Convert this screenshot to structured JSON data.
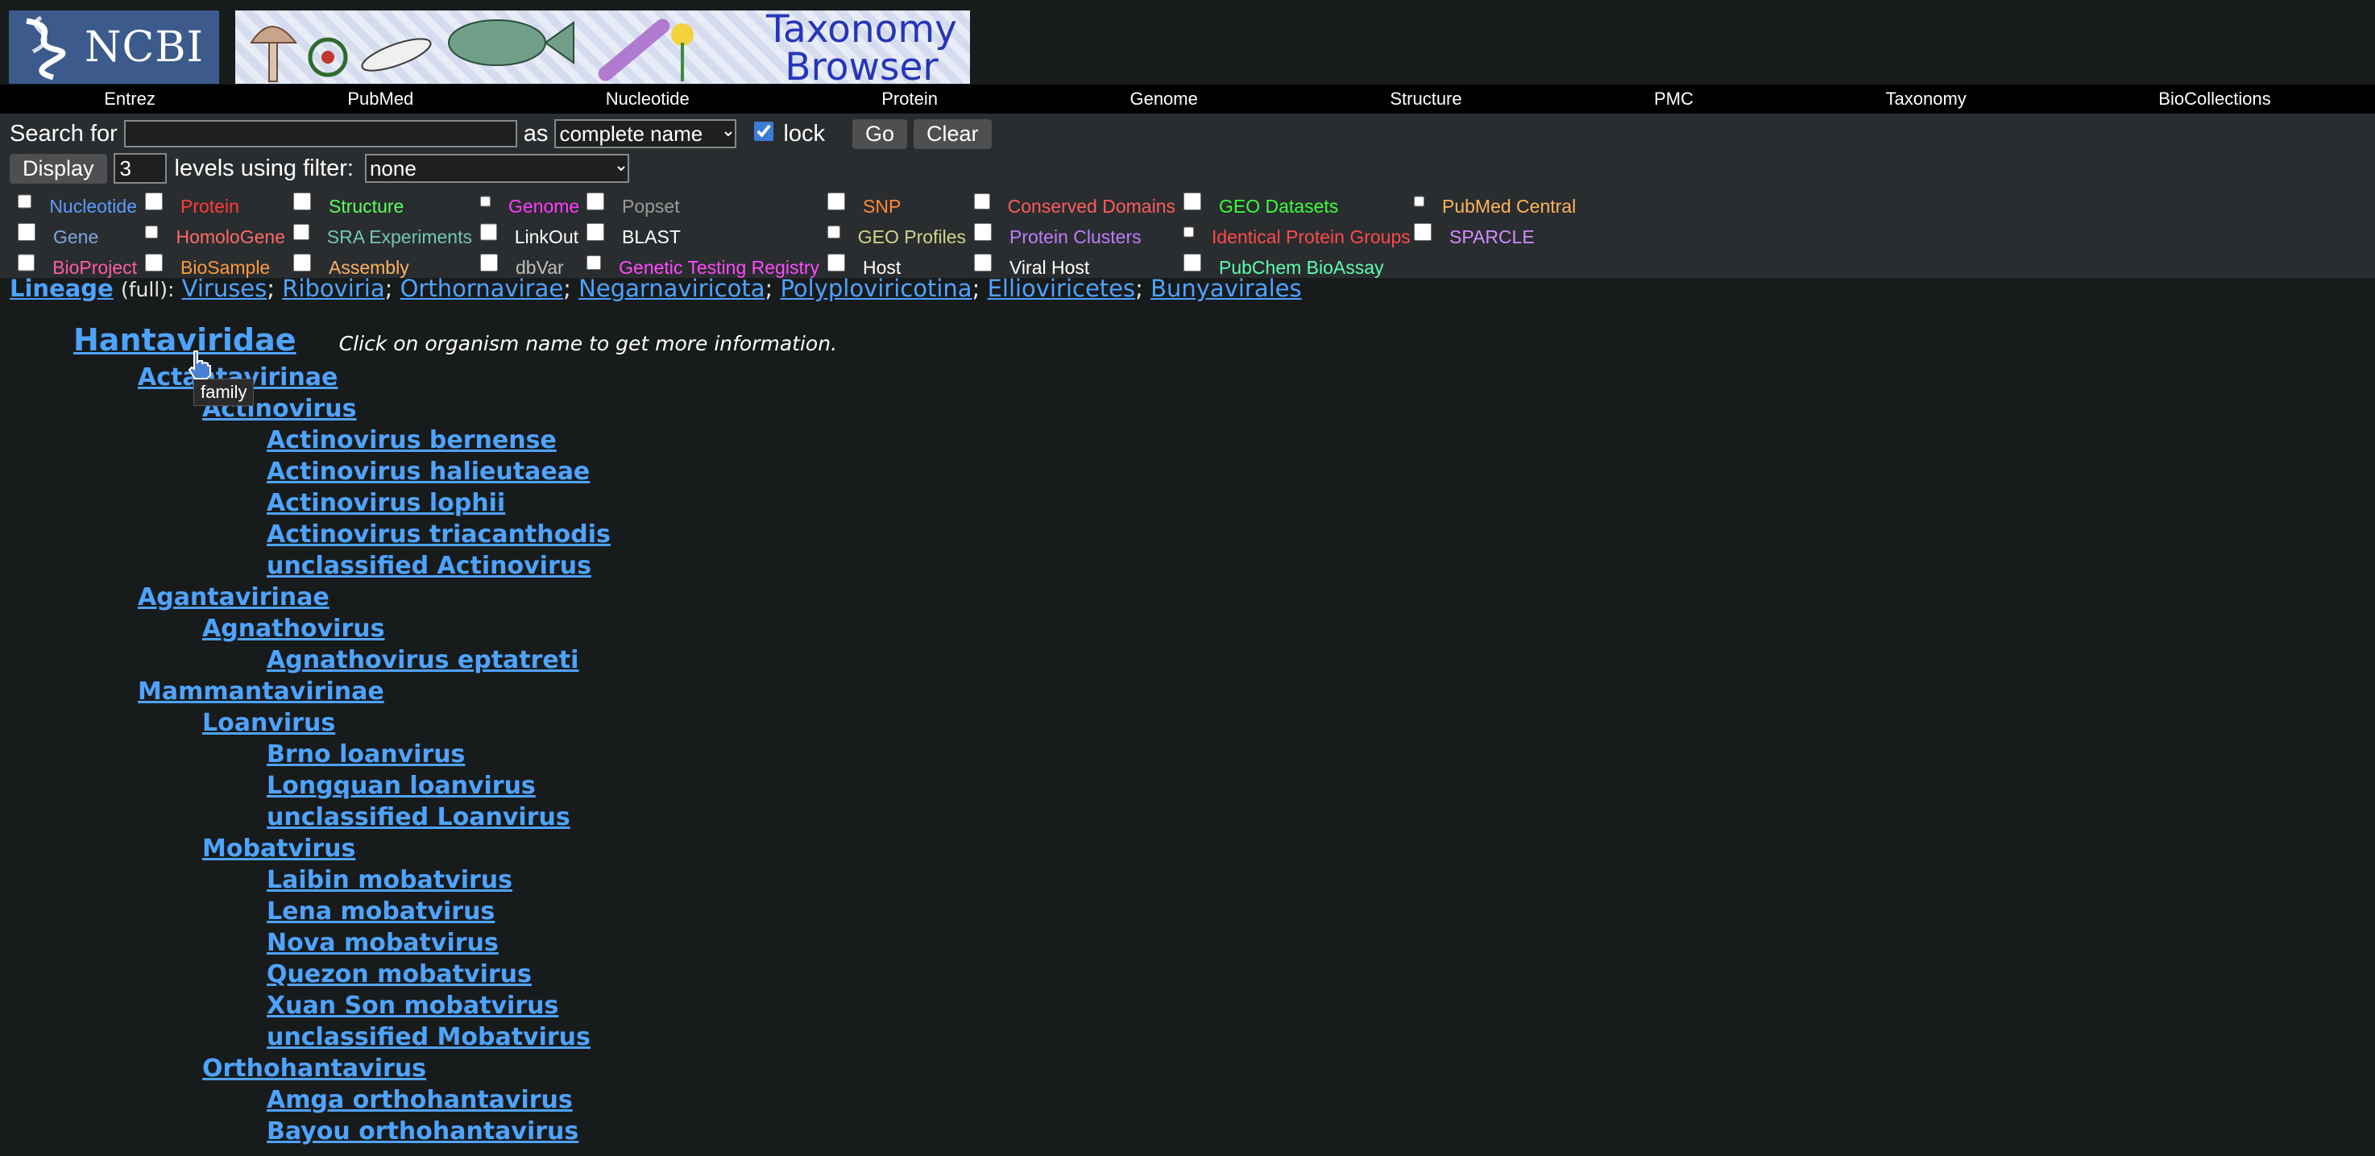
{
  "header": {
    "ncbi_logo_text": "NCBI",
    "banner_title_line1": "Taxonomy",
    "banner_title_line2": "Browser"
  },
  "nav": [
    "Entrez",
    "PubMed",
    "Nucleotide",
    "Protein",
    "Genome",
    "Structure",
    "PMC",
    "Taxonomy",
    "BioCollections"
  ],
  "search": {
    "search_for_label": "Search for",
    "query_value": "",
    "as_label": "as",
    "mode_selected": "complete name",
    "lock_label": "lock",
    "lock_checked": true,
    "go_label": "Go",
    "clear_label": "Clear",
    "display_label": "Display",
    "levels_value": "3",
    "levels_label": "levels using filter:",
    "filter_selected": "none"
  },
  "filters": [
    {
      "label": "Nucleotide",
      "color": "#5b9cff"
    },
    {
      "label": "Protein",
      "color": "#ff3b3b"
    },
    {
      "label": "Structure",
      "color": "#5cff5c"
    },
    {
      "label": "Genome",
      "color": "#ff3cff"
    },
    {
      "label": "Popset",
      "color": "#9a9a9a"
    },
    {
      "label": "SNP",
      "color": "#ff8a33"
    },
    {
      "label": "Conserved Domains",
      "color": "#ff5c5c"
    },
    {
      "label": "GEO Datasets",
      "color": "#3cff3c"
    },
    {
      "label": "PubMed Central",
      "color": "#ffb35c"
    },
    {
      "label": "Gene",
      "color": "#7fa6e0"
    },
    {
      "label": "HomoloGene",
      "color": "#ff6a6a"
    },
    {
      "label": "SRA Experiments",
      "color": "#6fc9b8"
    },
    {
      "label": "LinkOut",
      "color": "#ffffff"
    },
    {
      "label": "BLAST",
      "color": "#ffffff"
    },
    {
      "label": "GEO Profiles",
      "color": "#d4d48a"
    },
    {
      "label": "Protein Clusters",
      "color": "#c07cff"
    },
    {
      "label": "Identical Protein Groups",
      "color": "#ff4a4a"
    },
    {
      "label": "SPARCLE",
      "color": "#d08cff"
    },
    {
      "label": "BioProject",
      "color": "#ff5ca8"
    },
    {
      "label": "BioSample",
      "color": "#ff9a3c"
    },
    {
      "label": "Assembly",
      "color": "#ffb060"
    },
    {
      "label": "dbVar",
      "color": "#bfbfbf"
    },
    {
      "label": "Genetic Testing Registry",
      "color": "#ff4aff"
    },
    {
      "label": "Host",
      "color": "#ffffff"
    },
    {
      "label": "Viral Host",
      "color": "#ffffff"
    },
    {
      "label": "PubChem BioAssay",
      "color": "#5cffb0"
    }
  ],
  "lineage": {
    "label": "Lineage",
    "full": "(full):",
    "items": [
      "Viruses",
      "Riboviria",
      "Orthornavirae",
      "Negarnaviricota",
      "Polyploviricotina",
      "Ellioviricetes",
      "Bunyavirales"
    ]
  },
  "tree": {
    "root": "Hantaviridae",
    "hint": "Click on organism name to get more information.",
    "tooltip": "family",
    "items": [
      {
        "level": 1,
        "bullet": "circle",
        "name": "Actantavirinae"
      },
      {
        "level": 2,
        "bullet": "disc",
        "name": "Actinovirus"
      },
      {
        "level": 3,
        "bullet": "circle",
        "name": "Actinovirus bernense"
      },
      {
        "level": 3,
        "bullet": "circle",
        "name": "Actinovirus halieutaeae"
      },
      {
        "level": 3,
        "bullet": "circle",
        "name": "Actinovirus lophii"
      },
      {
        "level": 3,
        "bullet": "circle",
        "name": "Actinovirus triacanthodis"
      },
      {
        "level": 3,
        "bullet": "circle",
        "name": "unclassified Actinovirus"
      },
      {
        "level": 1,
        "bullet": "circle",
        "name": "Agantavirinae"
      },
      {
        "level": 2,
        "bullet": "disc",
        "name": "Agnathovirus"
      },
      {
        "level": 3,
        "bullet": "circle",
        "name": "Agnathovirus eptatreti"
      },
      {
        "level": 1,
        "bullet": "circle",
        "name": "Mammantavirinae"
      },
      {
        "level": 2,
        "bullet": "disc",
        "name": "Loanvirus"
      },
      {
        "level": 3,
        "bullet": "circle",
        "name": "Brno loanvirus"
      },
      {
        "level": 3,
        "bullet": "circle",
        "name": "Longquan loanvirus"
      },
      {
        "level": 3,
        "bullet": "circle",
        "name": "unclassified Loanvirus"
      },
      {
        "level": 2,
        "bullet": "disc",
        "name": "Mobatvirus"
      },
      {
        "level": 3,
        "bullet": "circle",
        "name": "Laibin mobatvirus"
      },
      {
        "level": 3,
        "bullet": "circle",
        "name": "Lena mobatvirus"
      },
      {
        "level": 3,
        "bullet": "circle",
        "name": "Nova mobatvirus"
      },
      {
        "level": 3,
        "bullet": "circle",
        "name": "Quezon mobatvirus"
      },
      {
        "level": 3,
        "bullet": "circle",
        "name": "Xuan Son mobatvirus"
      },
      {
        "level": 3,
        "bullet": "circle",
        "name": "unclassified Mobatvirus"
      },
      {
        "level": 2,
        "bullet": "disc",
        "name": "Orthohantavirus"
      },
      {
        "level": 3,
        "bullet": "circle",
        "name": "Amga orthohantavirus"
      },
      {
        "level": 3,
        "bullet": "square",
        "name": "Bayou orthohantavirus"
      }
    ]
  }
}
